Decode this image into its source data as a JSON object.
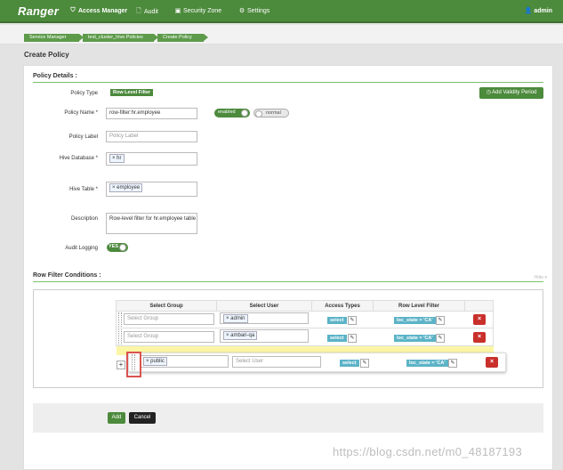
{
  "app": {
    "brand": "Ranger",
    "user": "admin"
  },
  "nav": {
    "access_manager": "Access Manager",
    "audit": "Audit",
    "security_zone": "Security Zone",
    "settings": "Settings"
  },
  "breadcrumb": [
    "Service Manager",
    "test_cluster_hive Policies",
    "Create Policy"
  ],
  "page_title": "Create Policy",
  "policy_details": {
    "header": "Policy Details :",
    "policy_type_label": "Policy Type",
    "policy_type_value": "Row Level Filter",
    "add_validity_label": "Add Validity Period",
    "policy_name_label": "Policy Name *",
    "policy_name_value": "row-filter:hr.employee",
    "enabled_label": "enabled",
    "normal_label": "normal",
    "policy_label_label": "Policy Label",
    "policy_label_placeholder": "Policy Label",
    "hive_database_label": "Hive Database *",
    "hive_database_tag": "hr",
    "hive_table_label": "Hive Table *",
    "hive_table_tag": "employee",
    "description_label": "Description",
    "description_value": "Row-level filter for hr.employee table",
    "audit_logging_label": "Audit Logging",
    "audit_logging_value": "YES"
  },
  "row_filter": {
    "header": "Row Filter Conditions :",
    "hide_label": "Hide",
    "columns": [
      "Select Group",
      "Select User",
      "Access Types",
      "Row Level Filter"
    ],
    "rows": [
      {
        "group_placeholder": "Select Group",
        "user": "admin",
        "access": "select",
        "filter": "loc_state = 'CA'"
      },
      {
        "group_placeholder": "Select Group",
        "user": "ambari-qa",
        "access": "select",
        "filter": "loc_state = 'CA'"
      },
      {
        "group": "public",
        "user_placeholder": "Select User",
        "access": "select",
        "filter": "loc_state = 'CA'"
      }
    ]
  },
  "buttons": {
    "add": "Add",
    "cancel": "Cancel",
    "plus": "+",
    "delete": "×"
  },
  "watermark": "https://blog.csdn.net/m0_48187193",
  "colors": {
    "brand_green": "#4c8a3c",
    "info_blue": "#5bb3c7",
    "danger_red": "#c9302c",
    "highlight": "#fbf6a6"
  }
}
